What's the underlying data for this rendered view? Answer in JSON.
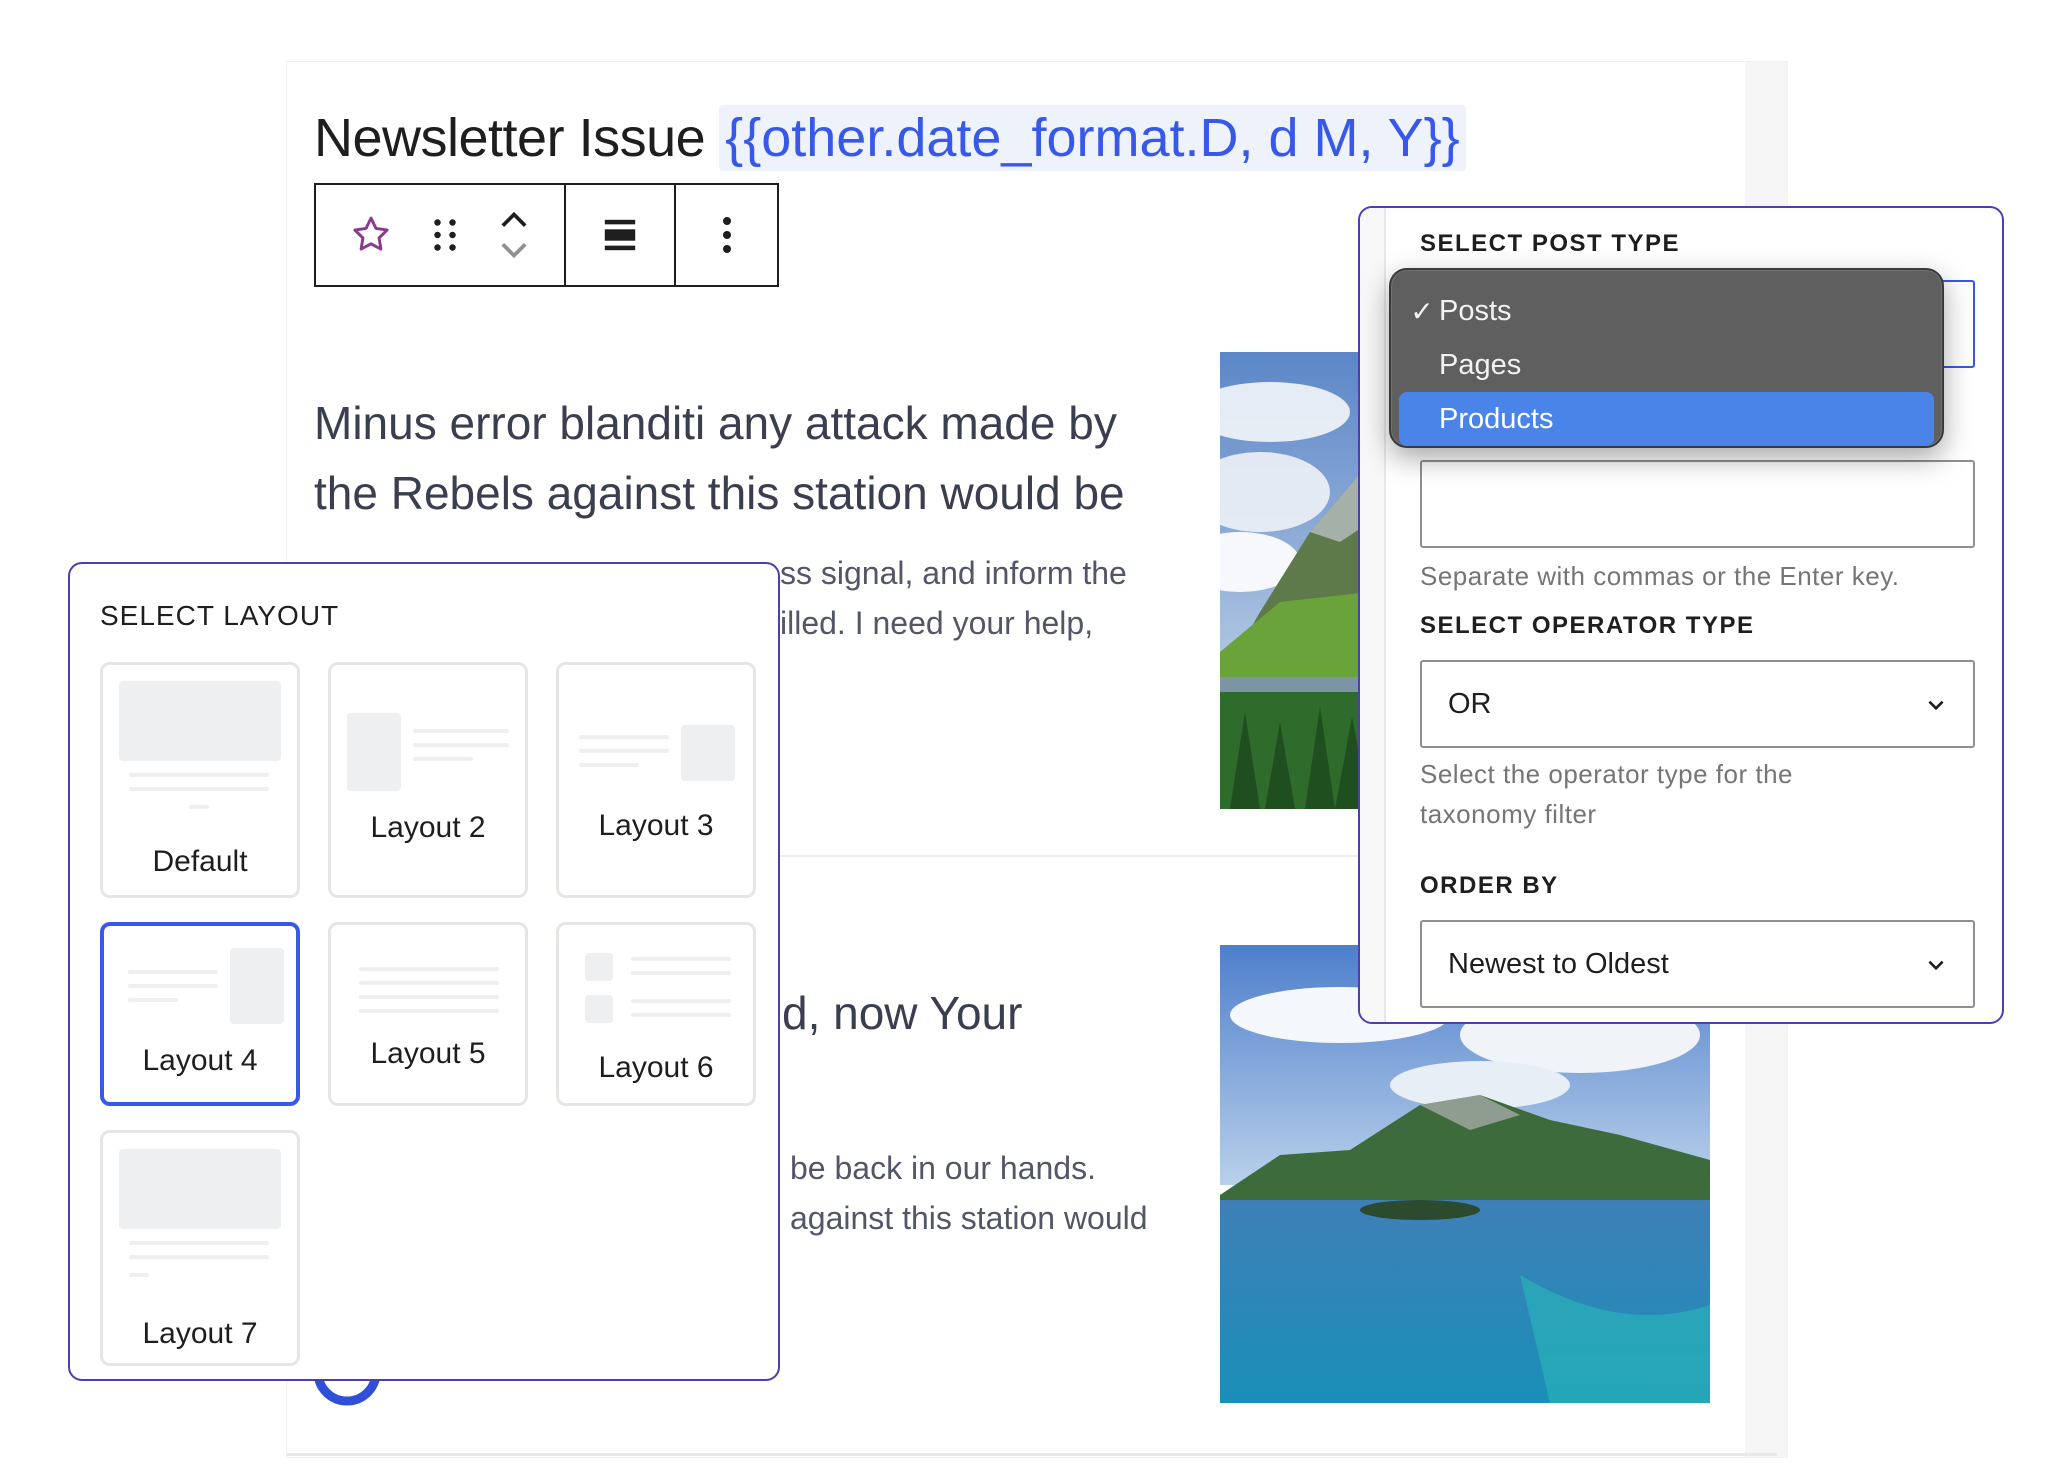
{
  "editor": {
    "title": "Newsletter Issue",
    "shortcode": "{{other.date_format.D, d M, Y}}",
    "toolbar": {
      "star_icon": "star-icon",
      "drag_icon": "drag-handle-icon",
      "move_icon": "move-up-down-icon",
      "align_icon": "align-icon",
      "more_icon": "more-vertical-icon"
    }
  },
  "article": {
    "heading_line1": "Minus error blanditi any attack made by",
    "heading_line2": "the Rebels against this station would be",
    "para1_line1": "ss signal, and inform the",
    "para1_line2": "illed. I need your help,",
    "heading2": "d, now Your",
    "para2_line1": "be back in our hands.",
    "para2_line2": "against this station would"
  },
  "layout_panel": {
    "label": "SELECT LAYOUT",
    "options": [
      "Default",
      "Layout 2",
      "Layout 3",
      "Layout 4",
      "Layout 5",
      "Layout 6",
      "Layout 7"
    ],
    "selected": "Layout 4"
  },
  "post_panel": {
    "post_type_label": "SELECT POST TYPE",
    "post_type_options": [
      "Posts",
      "Pages",
      "Products"
    ],
    "post_type_checked": "Posts",
    "post_type_highlighted": "Products",
    "terms_help": "Separate with commas or the Enter key.",
    "operator_label": "SELECT OPERATOR TYPE",
    "operator_value": "OR",
    "operator_help_line1": "Select the operator type for the",
    "operator_help_line2": "taxonomy filter",
    "order_label": "ORDER BY",
    "order_value": "Newest to Oldest"
  },
  "colors": {
    "accent": "#3858e9",
    "panel_border": "#4b3fb1",
    "menu_highlight": "#4a84e8"
  }
}
